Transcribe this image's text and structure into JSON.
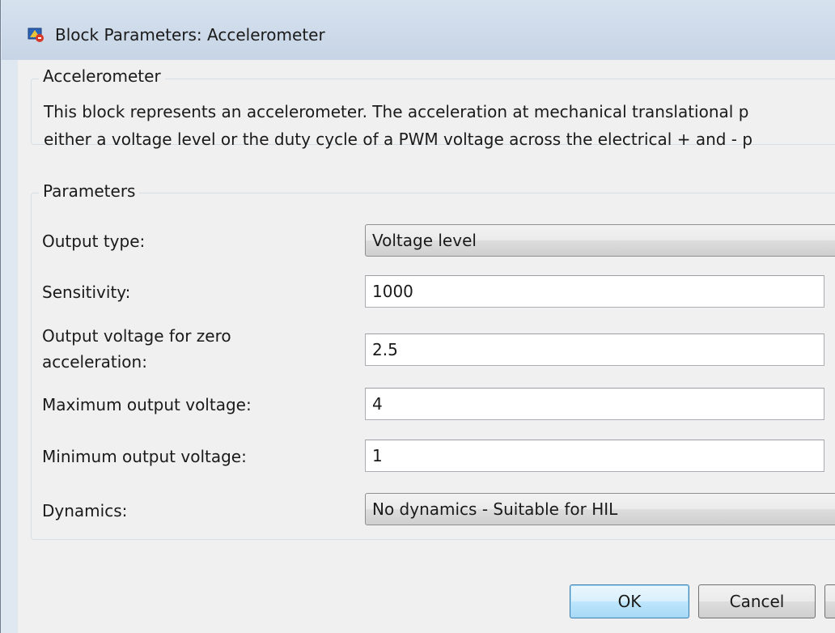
{
  "window": {
    "title": "Block Parameters: Accelerometer",
    "icon": "simulink-block-icon"
  },
  "description_group": {
    "label": "Accelerometer",
    "line1": "This block represents an accelerometer. The acceleration at mechanical translational p",
    "line2": "either a voltage level or the duty cycle of a PWM voltage across the electrical + and - p"
  },
  "parameters_group": {
    "label": "Parameters",
    "output_type": {
      "label": "Output type:",
      "value": "Voltage level"
    },
    "sensitivity": {
      "label": "Sensitivity:",
      "value": "1000"
    },
    "zero_accel": {
      "label_line1": "Output voltage for zero",
      "label_line2": "acceleration:",
      "value": "2.5"
    },
    "max_voltage": {
      "label": "Maximum output voltage:",
      "value": "4"
    },
    "min_voltage": {
      "label": "Minimum output voltage:",
      "value": "1"
    },
    "dynamics": {
      "label": "Dynamics:",
      "value": "No dynamics - Suitable for HIL"
    }
  },
  "buttons": {
    "ok": "OK",
    "cancel": "Cancel"
  }
}
